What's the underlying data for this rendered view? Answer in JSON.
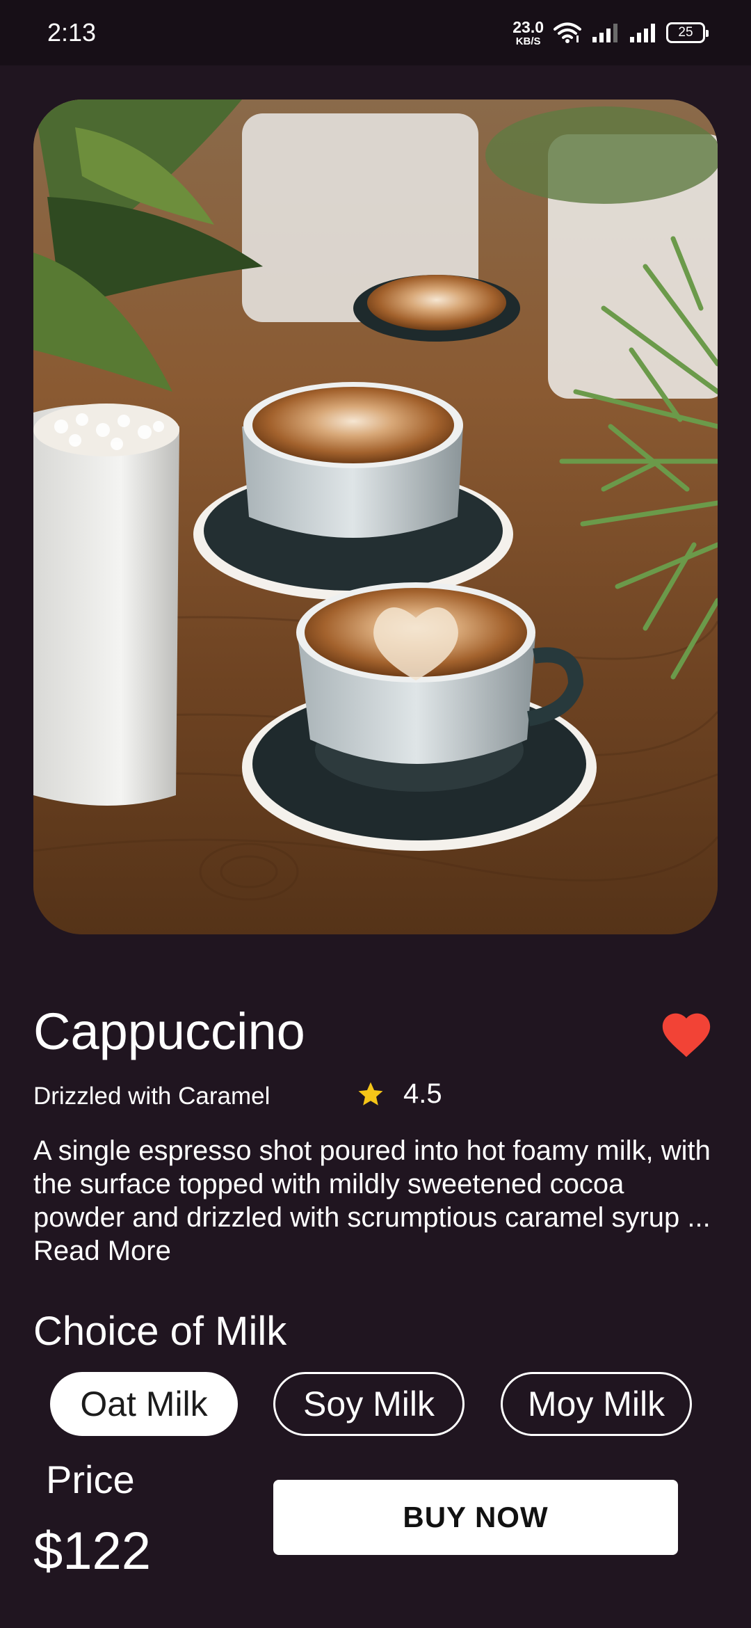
{
  "status_bar": {
    "time": "2:13",
    "net_speed_value": "23.0",
    "net_speed_unit": "KB/S",
    "battery": "25",
    "icons": [
      "wifi-icon",
      "signal-icon",
      "signal-icon",
      "battery-icon"
    ]
  },
  "product": {
    "image_icon": "coffee-photo",
    "title": "Cappuccino",
    "subtitle": "Drizzled with Caramel",
    "rating": "4.5",
    "description": "A single espresso shot poured into hot foamy milk, with the surface topped with mildly sweetened cocoa powder and drizzled with scrumptious caramel syrup ...",
    "read_more": " Read More",
    "favorite": true
  },
  "milk": {
    "title": "Choice of Milk",
    "options": [
      {
        "label": "Oat Milk",
        "selected": true
      },
      {
        "label": "Soy Milk",
        "selected": false
      },
      {
        "label": "Moy Milk",
        "selected": false
      }
    ]
  },
  "price": {
    "label": "Price",
    "value": "$122"
  },
  "actions": {
    "buy_label": "BUY NOW"
  },
  "colors": {
    "background": "#201520",
    "status_bar": "#170f17",
    "heart": "#f24336",
    "star": "#f5c518",
    "button": "#ffffff"
  }
}
